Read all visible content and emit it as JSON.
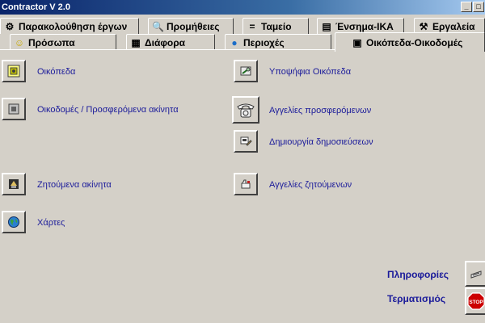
{
  "window": {
    "title": "Contractor V 2.0",
    "min_glyph": "_",
    "max_glyph": "□"
  },
  "tabs_row1": [
    {
      "label": "Παρακολούθηση έργων",
      "icon": "gear-icon",
      "glyph": "⚙"
    },
    {
      "label": "Προμήθειες",
      "icon": "magnifier-icon",
      "glyph": "🔍"
    },
    {
      "label": "Ταμείο",
      "icon": "cash-register-icon",
      "glyph": "="
    },
    {
      "label": "Ένσημα-ΙΚΑ",
      "icon": "document-icon",
      "glyph": "▤"
    },
    {
      "label": "Εργαλεία",
      "icon": "tools-icon",
      "glyph": "⚒"
    }
  ],
  "tabs_row2": [
    {
      "label": "Πρόσωπα",
      "icon": "smiley-icon",
      "glyph": "☺"
    },
    {
      "label": "Διάφορα",
      "icon": "grid-icon",
      "glyph": "▦"
    },
    {
      "label": "Περιοχές",
      "icon": "globe-icon",
      "glyph": "●"
    },
    {
      "label": "Οικόπεδα-Οικοδομές",
      "icon": "book-icon",
      "glyph": "▣",
      "active": true
    }
  ],
  "left_items": [
    {
      "label": "Οικόπεδα",
      "icon": "plot-icon"
    },
    {
      "label": "Οικοδομές / Προσφερόμενα ακίνητα",
      "icon": "building-icon"
    },
    {
      "label": "Ζητούμενα ακίνητα",
      "icon": "request-icon"
    },
    {
      "label": "Χάρτες",
      "icon": "globe-icon"
    }
  ],
  "right_items": [
    {
      "label": "Υποψήφια Οικόπεδα",
      "icon": "candidate-icon"
    },
    {
      "label": "Αγγελίες προσφερόμενων",
      "icon": "telephone-icon"
    },
    {
      "label": "Δημιουργία δημοσιεύσεων",
      "icon": "publish-icon"
    },
    {
      "label": "Αγγελίες ζητούμενων",
      "icon": "ads-icon"
    }
  ],
  "bottom": {
    "info_label": "Πληροφορίες",
    "exit_label": "Τερματισμός",
    "stop_text": "STOP"
  },
  "colors": {
    "face": "#d4d0c8",
    "link": "#1a1a9a",
    "title_start": "#0a246a",
    "stop_red": "#cc0000"
  }
}
